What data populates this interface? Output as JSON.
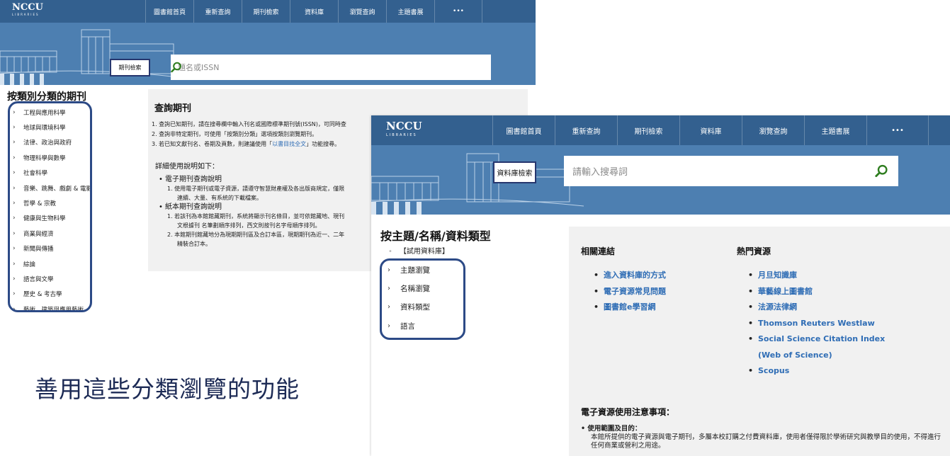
{
  "shot1": {
    "logo": {
      "main": "NCCU",
      "sub": "LIBRARIES"
    },
    "nav": [
      "圖書館首頁",
      "重新查詢",
      "期刊檢索",
      "資料庫",
      "瀏覽查詢",
      "主題書展",
      "•••"
    ],
    "mode_label": "期刊檢索",
    "search_placeholder": "題名或ISSN",
    "sidebar_title": "按類別分類的期刊",
    "categories": [
      "工程與應用科學",
      "地球與環境科學",
      "法律、政治與政府",
      "物理科學與數學",
      "社會科學",
      "音樂、跳舞、戲劇 & 電影",
      "哲學 & 宗教",
      "健康與生物科學",
      "商業與經濟",
      "新聞與傳播",
      "綜論",
      "語言與文學",
      "歷史 & 考古學",
      "藝術、建築與應用藝術"
    ],
    "panel_title": "查詢期刊",
    "steps": [
      {
        "prefix": "1. 查詢已知期刊，請在搜尋欄中輸入刊名或國際標準期刊號(ISSN)，可同時查",
        "link": "",
        "suffix": ""
      },
      {
        "prefix": "2. 查詢非特定期刊，可使用「按類別分類」選項按類別瀏覽期刊。",
        "link": "",
        "suffix": ""
      },
      {
        "prefix": "3. 若已知文獻刊名、卷期及頁數，則建議使用「",
        "link": "以書目找全文",
        "suffix": "」功能搜尋。"
      }
    ],
    "detail_label": "詳細使用說明如下：",
    "help": {
      "ejournal_title": "電子期刊查詢說明",
      "ejournal_lines": [
        "1.  使用電子期刊或電子資源，請遵守智慧財產權及各出版商規定，僅限",
        "連續、大量、有系統的下載檔案。"
      ],
      "print_title": "紙本期刊查詢說明",
      "print_lines": [
        "1.  若該刊為本館館藏期刊，系統將顯示刊名條目，並可依館藏地、現刊",
        "文根據刊 名筆劃順序排列，西文則按刊名字母順序排列。",
        "2.  本館期刊館藏地分為現期期刊區及合訂本區，現期期刊為近一、二年",
        "精裝合訂本。"
      ]
    }
  },
  "caption": "善用這些分類瀏覽的功能",
  "shot2": {
    "logo": {
      "main": "NCCU",
      "sub": "LIBRARIES"
    },
    "nav": [
      "圖書館首頁",
      "重新查詢",
      "期刊檢索",
      "資料庫",
      "瀏覽查詢",
      "主題書展",
      "•••"
    ],
    "mode_label": "資料庫檢索",
    "search_placeholder": "請輸入搜尋詞",
    "cat_title": "按主題/名稱/資料類型",
    "trial": "【試用資料庫】",
    "browse": [
      "主題瀏覽",
      "名稱瀏覽",
      "資料類型",
      "語言"
    ],
    "related_title": "相關連結",
    "related": [
      "進入資料庫的方式",
      "電子資源常見問題",
      "圖書館e學習網"
    ],
    "hot_title": "熱門資源",
    "hot": [
      "月旦知識庫",
      "華藝線上圖書館",
      "法源法律網",
      "Thomson Reuters Westlaw",
      "Social Science Citation Index",
      "Scopus"
    ],
    "hot_wrap": "(Web of Science)",
    "notice_title": "電子資源使用注意事項：",
    "notice_head": "使用範圍及目的：",
    "notice_body": "本館所提供的電子資源與電子期刊，多屬本校訂購之付費資料庫，使用者僅得限於學術研究與教學目的使用，不得進行任何商業或營利之用途。"
  },
  "colors": {
    "header": "#33608f",
    "hero": "#4d7fb1",
    "link": "#2f6db5",
    "highlight_ring": "#2c4a86",
    "caption": "#1c2a55"
  }
}
